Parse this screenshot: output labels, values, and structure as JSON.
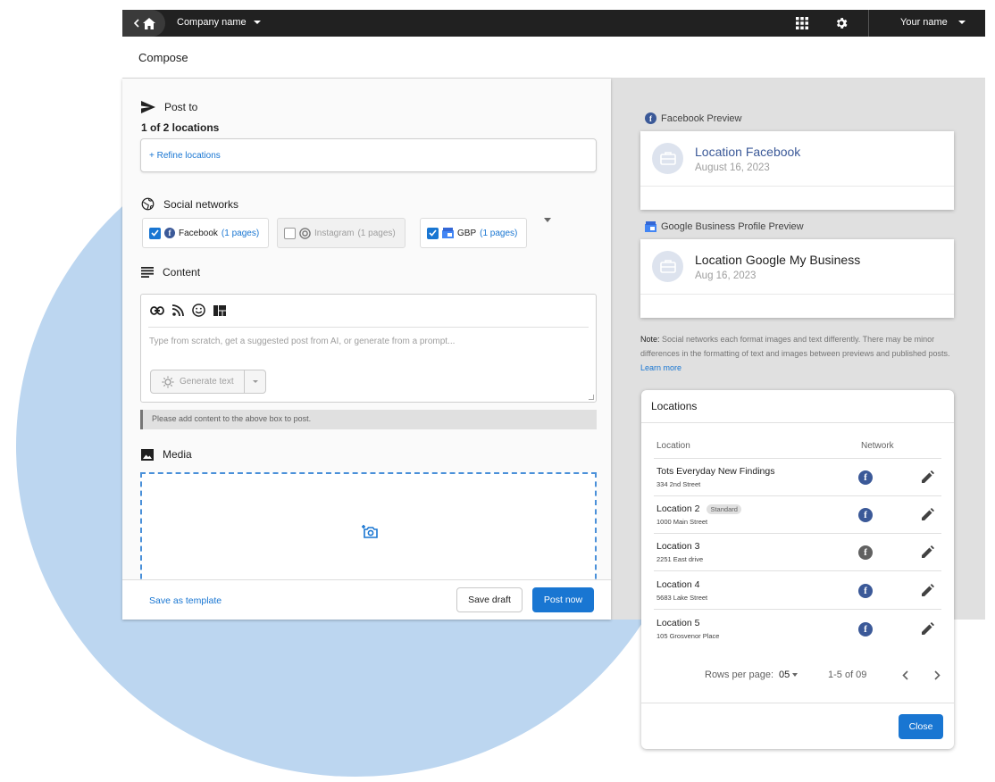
{
  "topbar": {
    "company": "Company name",
    "user": "Your name"
  },
  "compose": {
    "title": "Compose"
  },
  "post_to": {
    "label": "Post to",
    "summary": "1 of 2 locations",
    "refine": "+ Refine locations"
  },
  "social": {
    "label": "Social networks",
    "chips": [
      {
        "name": "Facebook",
        "pages": "(1 pages)",
        "checked": true
      },
      {
        "name": "Instagram",
        "pages": "(1 pages)",
        "checked": false
      },
      {
        "name": "GBP",
        "pages": "(1 pages)",
        "checked": true
      }
    ]
  },
  "content": {
    "label": "Content",
    "placeholder": "Type from scratch, get a suggested post from AI, or generate from a prompt...",
    "generate": "Generate text",
    "alert": "Please add content to the above box to post."
  },
  "media": {
    "label": "Media"
  },
  "footer": {
    "save_template": "Save as template",
    "save_draft": "Save draft",
    "post_now": "Post now"
  },
  "preview_fb": {
    "label": "Facebook Preview",
    "name": "Location Facebook",
    "date": "August 16, 2023"
  },
  "preview_gbp": {
    "label": "Google Business Profile Preview",
    "name": "Location Google My Business",
    "date": "Aug 16, 2023"
  },
  "note": {
    "prefix": "Note:",
    "text": "Social networks each format images and text differently. There may be minor differences in the formatting of text and images between previews and published posts.",
    "link": "Learn more"
  },
  "locations": {
    "title": "Locations",
    "col_location": "Location",
    "col_network": "Network",
    "rows": [
      {
        "name": "Tots Everyday New Findings",
        "tag": "",
        "addr": "334 2nd Street",
        "active": true
      },
      {
        "name": "Location 2",
        "tag": "Standard",
        "addr": "1000 Main Street",
        "active": true
      },
      {
        "name": "Location 3",
        "tag": "",
        "addr": "2251 East drive",
        "active": false
      },
      {
        "name": "Location 4",
        "tag": "",
        "addr": "5683 Lake Street",
        "active": true
      },
      {
        "name": "Location 5",
        "tag": "",
        "addr": "105 Grosvenor Place",
        "active": true
      }
    ],
    "rows_per_page_label": "Rows per page:",
    "rows_per_page": "05",
    "range": "1-5 of 09",
    "close": "Close"
  },
  "colors": {
    "primary": "#1976d2",
    "facebook": "#3b5998",
    "inactive_network": "#616161",
    "blob": "#bcd6f0"
  }
}
